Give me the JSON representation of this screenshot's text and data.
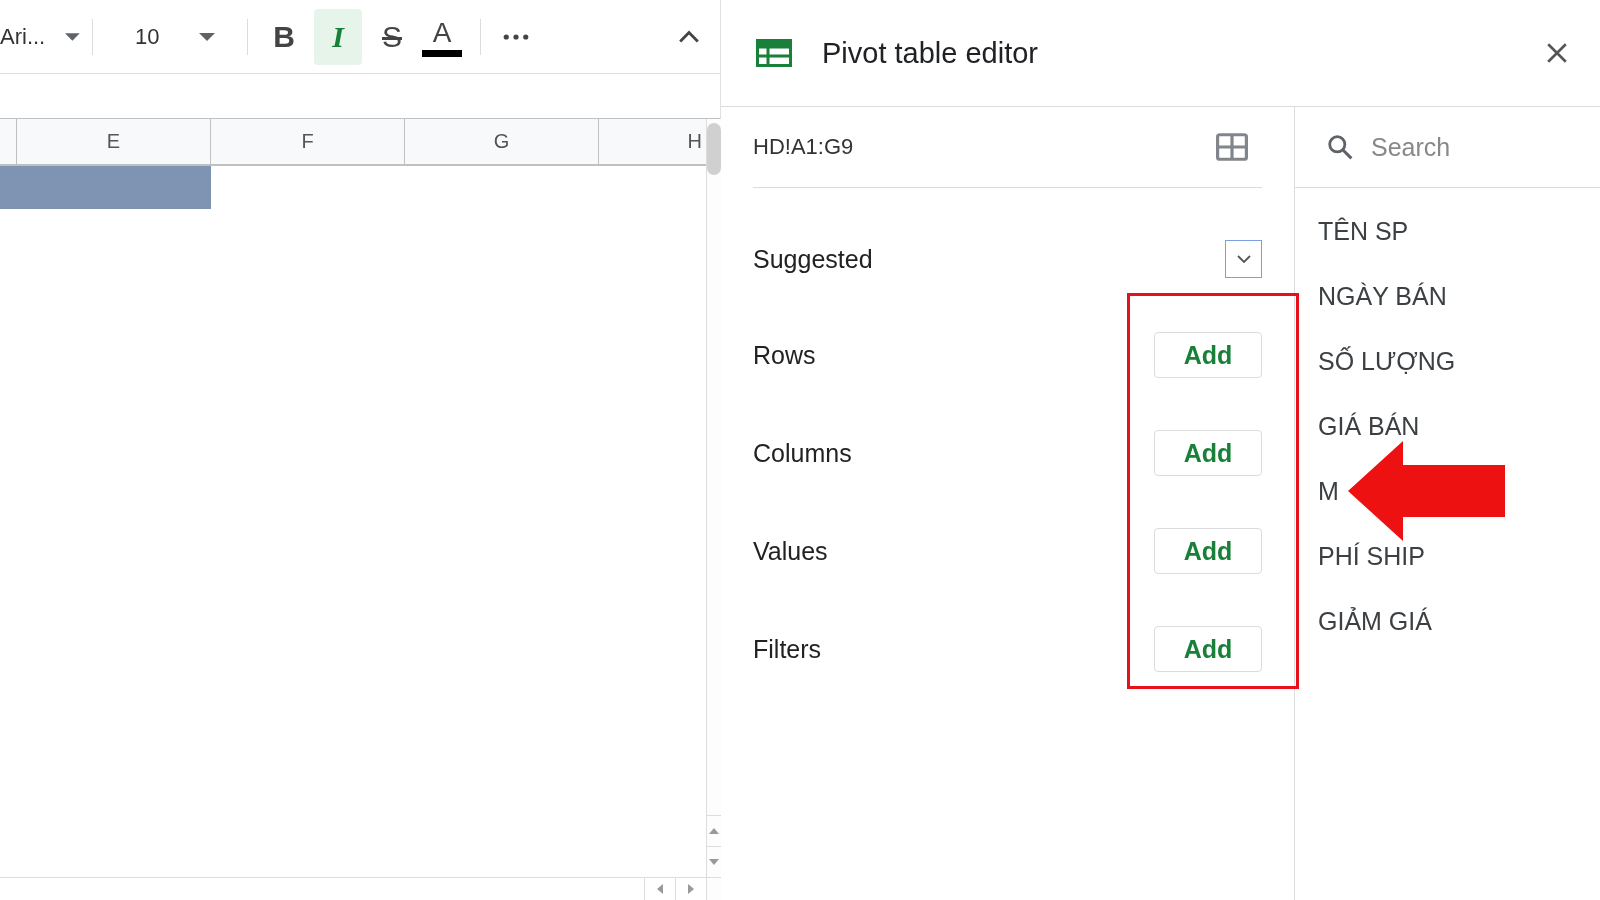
{
  "toolbar": {
    "font": "Ari...",
    "font_size": "10",
    "format_buttons": [
      {
        "label": "B",
        "kind": "bold",
        "active": false
      },
      {
        "label": "I",
        "kind": "italic",
        "active": true
      },
      {
        "label": "S",
        "kind": "strike",
        "active": false
      },
      {
        "label": "A",
        "kind": "color",
        "active": false
      }
    ]
  },
  "sheet": {
    "columns": [
      "E",
      "F",
      "G",
      "H"
    ]
  },
  "editor": {
    "title": "Pivot table editor",
    "range": "HD!A1:G9",
    "suggested": "Suggested",
    "sections": [
      {
        "label": "Rows",
        "button": "Add"
      },
      {
        "label": "Columns",
        "button": "Add"
      },
      {
        "label": "Values",
        "button": "Add"
      },
      {
        "label": "Filters",
        "button": "Add"
      }
    ]
  },
  "fields": {
    "placeholder": "Search",
    "items": [
      "TÊN SP",
      "NGÀY BÁN",
      "SỐ LƯỢNG",
      "GIÁ BÁN",
      "M",
      "PHÍ SHIP",
      "GIẢM GIÁ"
    ]
  }
}
